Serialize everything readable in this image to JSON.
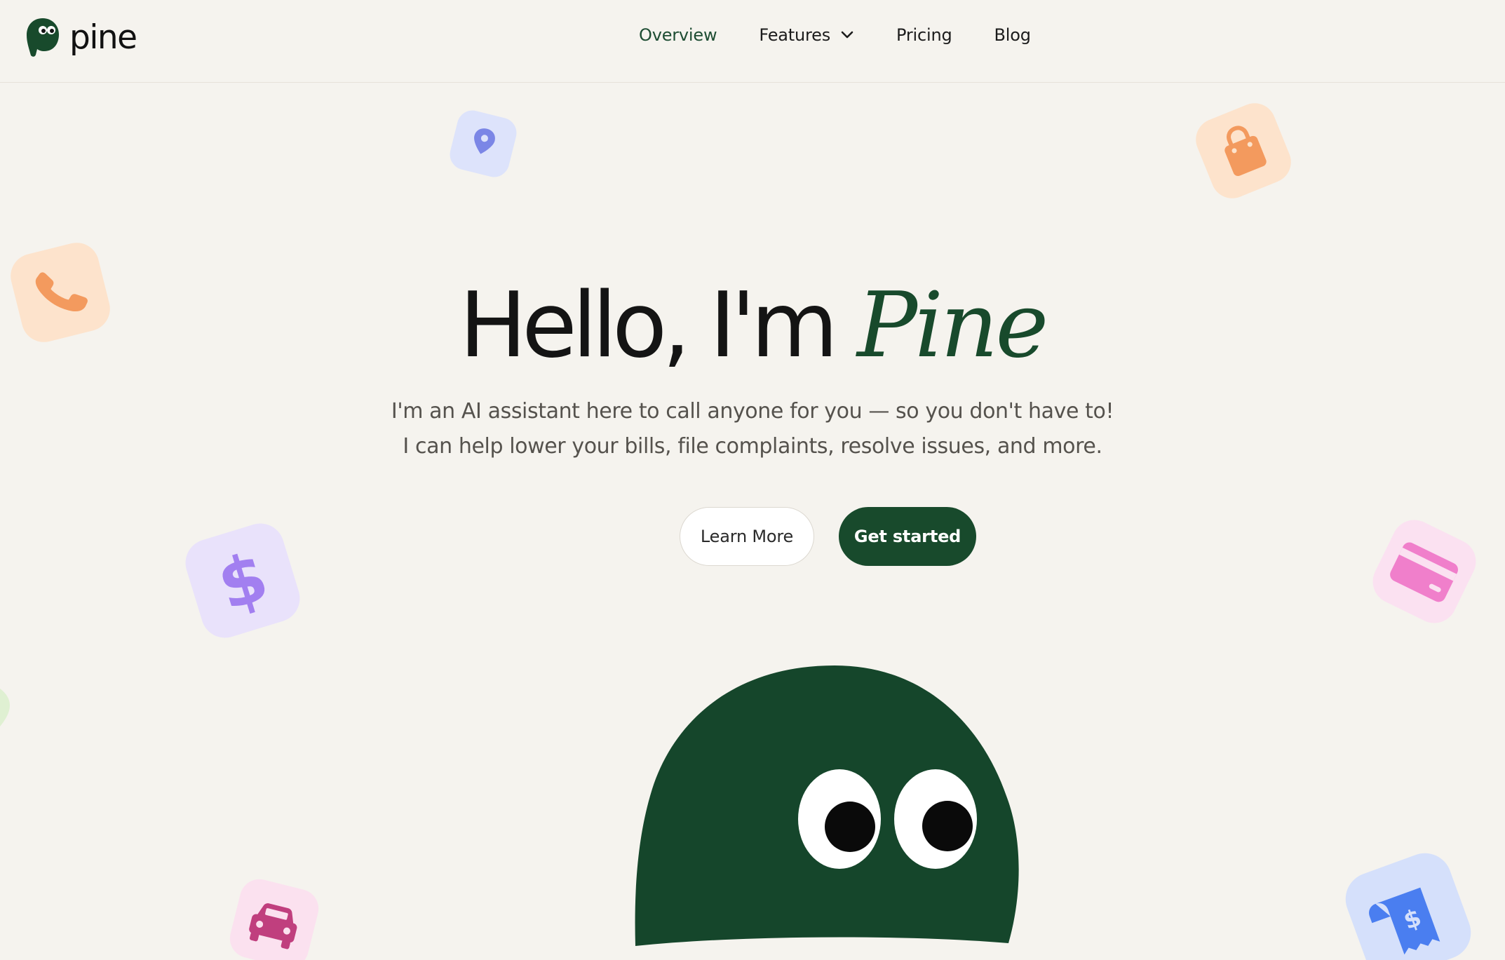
{
  "brand": {
    "name": "pine",
    "color": "#184a2c"
  },
  "nav": {
    "items": [
      {
        "label": "Overview",
        "active": true
      },
      {
        "label": "Features",
        "has_dropdown": true
      },
      {
        "label": "Pricing"
      },
      {
        "label": "Blog"
      }
    ]
  },
  "hero": {
    "title_prefix": "Hello, I'm",
    "title_accent": "Pine",
    "subtitle_line1": "I'm an AI assistant here to call anyone for you — so you don't have to!",
    "subtitle_line2": "I can help lower your bills, file complaints, resolve issues, and more.",
    "learn_more_label": "Learn More",
    "get_started_label": "Get started"
  },
  "decorations": [
    {
      "icon": "location-pin-icon",
      "color": "#7b86e6",
      "bg": "#dde3fb"
    },
    {
      "icon": "shopping-bag-icon",
      "color": "#f39a5e",
      "bg": "#fde3cc"
    },
    {
      "icon": "phone-icon",
      "color": "#f39a5e",
      "bg": "#fde3cc"
    },
    {
      "icon": "dollar-icon",
      "color": "#a27ff0",
      "bg": "#e9e2fb"
    },
    {
      "icon": "credit-card-icon",
      "color": "#f07fcb",
      "bg": "#fbe1f1"
    },
    {
      "icon": "car-icon",
      "color": "#c03f7e",
      "bg": "#fbe1ef"
    },
    {
      "icon": "receipt-icon",
      "color": "#4a7ef0",
      "bg": "#d5e0fb"
    }
  ]
}
